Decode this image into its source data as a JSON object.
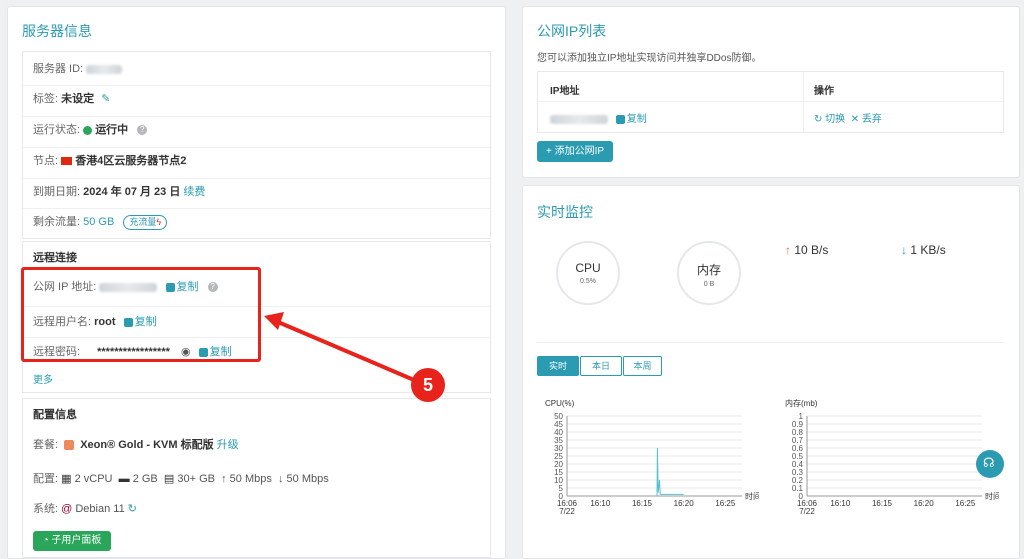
{
  "server": {
    "title": "服务器信息",
    "id_label": "服务器 ID:",
    "tag_label": "标签:",
    "tag_value": "未设定",
    "status_label": "运行状态:",
    "status_value": "运行中",
    "node_label": "节点:",
    "node_value": "香港4区云服务器节点2",
    "expire_label": "到期日期:",
    "expire_value": "2024 年 07 月 23 日",
    "renew_label": "续费",
    "traffic_label": "剩余流量:",
    "traffic_value": "50 GB",
    "recharge_label": "充流量"
  },
  "remote": {
    "title": "远程连接",
    "ip_label": "公网 IP 地址:",
    "user_label": "远程用户名:",
    "user_value": "root",
    "pass_label": "远程密码:",
    "pass_value": "*****************",
    "copy_label": "复制",
    "more_label": "更多"
  },
  "config": {
    "title": "配置信息",
    "plan_label": "套餐:",
    "plan_value": "Xeon® Gold - KVM 标配版",
    "upgrade_label": "升级",
    "spec_label": "配置:",
    "cpu": "2 vCPU",
    "ram": "2 GB",
    "disk": "30+ GB",
    "up": "↑ 50 Mbps",
    "down": "↓ 50 Mbps",
    "os_label": "系统:",
    "os_value": "Debian 11",
    "subpanel_label": "子用户面板"
  },
  "ip_list": {
    "title": "公网IP列表",
    "desc": "您可以添加独立IP地址实现访问并独享DDos防御。",
    "col_ip": "IP地址",
    "col_action": "操作",
    "copy_label": "复制",
    "switch_label": "切换",
    "discard_label": "丢弃",
    "add_label": "+ 添加公网IP"
  },
  "monitor": {
    "title": "实时监控",
    "cpu_label": "CPU",
    "cpu_value": "0.5%",
    "mem_label": "内存",
    "mem_value": "0 B",
    "net_up": "10 B/s",
    "net_down": "1 KB/s",
    "tabs": [
      "实时",
      "本日",
      "本周"
    ],
    "active_tab": 0
  },
  "annotation": {
    "marker": "5"
  },
  "chart_data": [
    {
      "type": "line",
      "title": "CPU(%)",
      "ylim": [
        0,
        50
      ],
      "yticks": [
        0,
        5,
        10,
        15,
        20,
        25,
        30,
        35,
        40,
        45,
        50
      ],
      "xticks": [
        "16:06\n7/22",
        "16:10",
        "16:15",
        "16:20",
        "16:25"
      ],
      "xlabel": "时间",
      "series": [
        {
          "values": [
            [
              16.8,
              0
            ],
            [
              16.85,
              30
            ],
            [
              16.95,
              2
            ],
            [
              17.1,
              10
            ],
            [
              17.2,
              1
            ],
            [
              17.4,
              1
            ],
            [
              18.0,
              1
            ],
            [
              20.0,
              1
            ]
          ]
        }
      ],
      "x": {
        "min_minutes": 0,
        "max_minutes": 21
      }
    },
    {
      "type": "line",
      "title": "内存(mb)",
      "ylim": [
        0,
        1
      ],
      "yticks": [
        0,
        0.1,
        0.2,
        0.3,
        0.4,
        0.5,
        0.6,
        0.7,
        0.8,
        0.9,
        1
      ],
      "xticks": [
        "16:06\n7/22",
        "16:10",
        "16:15",
        "16:20",
        "16:25"
      ],
      "xlabel": "时间",
      "series": []
    }
  ]
}
